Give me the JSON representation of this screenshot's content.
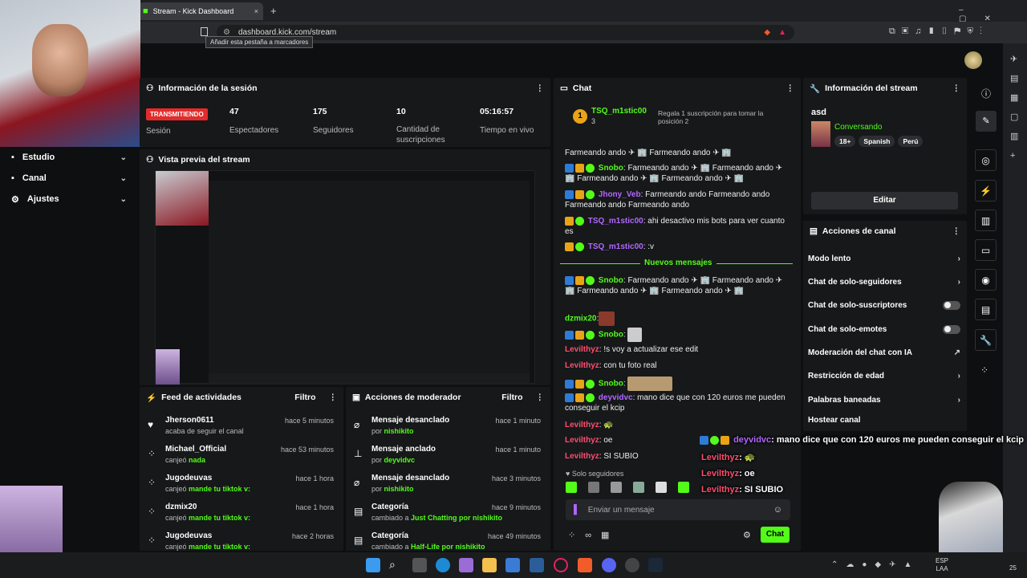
{
  "browser": {
    "tab_title": "Stream - Kick Dashboard",
    "url": "dashboard.kick.com/stream",
    "tooltip": "Añadir esta pestaña a marcadores",
    "new_tab": "+",
    "close_tab": "×"
  },
  "sidebar": {
    "items": [
      {
        "label": "Estudio",
        "icon": "studio-icon"
      },
      {
        "label": "Canal",
        "icon": "channel-icon"
      },
      {
        "label": "Ajustes",
        "icon": "gear-icon"
      }
    ]
  },
  "session": {
    "title": "Información de la sesión",
    "live_badge": "TRANSMITIENDO",
    "live_label": "Sesión",
    "stats": [
      {
        "value": "47",
        "label": "Espectadores"
      },
      {
        "value": "175",
        "label": "Seguidores"
      },
      {
        "value": "10",
        "label": "Cantidad de suscripciones"
      },
      {
        "value": "05:16:57",
        "label": "Tiempo en vivo"
      }
    ]
  },
  "preview": {
    "title": "Vista previa del stream"
  },
  "activity": {
    "title": "Feed de actividades",
    "filter": "Filtro",
    "rows": [
      {
        "icon": "heart-icon",
        "name": "Jherson0611",
        "sub": "acaba de seguir el canal",
        "bold": "",
        "time": "hace 5 minutos"
      },
      {
        "icon": "kicks-icon",
        "name": "Michael_Official",
        "sub": "canjeó ",
        "bold": "nada",
        "time": "hace 53 minutos"
      },
      {
        "icon": "kicks-icon",
        "name": "Jugodeuvas",
        "sub": "canjeó ",
        "bold": "mande tu tiktok v:",
        "time": "hace 1 hora"
      },
      {
        "icon": "kicks-icon",
        "name": "dzmix20",
        "sub": "canjeó ",
        "bold": "mande tu tiktok v:",
        "time": "hace 1 hora"
      },
      {
        "icon": "kicks-icon",
        "name": "Jugodeuvas",
        "sub": "canjeó ",
        "bold": "mande tu tiktok v:",
        "time": "hace 2 horas"
      }
    ]
  },
  "modactions": {
    "title": "Acciones de moderador",
    "filter": "Filtro",
    "rows": [
      {
        "icon": "unpin-icon",
        "name": "Mensaje desanclado",
        "sub": "por ",
        "bold": "nishikito",
        "time": "hace 1 minuto"
      },
      {
        "icon": "pin-icon",
        "name": "Mensaje anclado",
        "sub": "por ",
        "bold": "deyvidvc",
        "time": "hace 1 minuto"
      },
      {
        "icon": "unpin-icon",
        "name": "Mensaje desanclado",
        "sub": "por ",
        "bold": "nishikito",
        "time": "hace 3 minutos"
      },
      {
        "icon": "category-icon",
        "name": "Categoría",
        "sub": "cambiado a ",
        "bold": "Just Chatting por nishikito",
        "time": "hace 9 minutos"
      },
      {
        "icon": "category-icon",
        "name": "Categoría",
        "sub": "cambiado a ",
        "bold": "Half-Life por nishikito",
        "time": "hace 49 minutos"
      }
    ]
  },
  "chat": {
    "title": "Chat",
    "pinned_user": "TSQ_m1stic00",
    "pinned_count": "3",
    "gift_text": "Regala 1 suscripción para tomar la posición 2",
    "new_messages": "Nuevos mensajes",
    "messages": [
      {
        "user": "",
        "text": "Farmeando ando ✈ 🏢 Farmeando ando ✈ 🏢"
      },
      {
        "user": "Snobo",
        "text": ": Farmeando ando ✈ 🏢 Farmeando ando ✈ 🏢 Farmeando ando ✈ 🏢 Farmeando ando ✈ 🏢"
      },
      {
        "user": "Jhony_Veb",
        "text": ": Farmeando ando Farmeando ando Farmeando ando Farmeando ando"
      },
      {
        "user": "TSQ_m1stic00",
        "text": ": ahi desactivo mis bots para ver cuanto es"
      },
      {
        "user": "TSQ_m1stic00",
        "text": ": :v"
      },
      {
        "user": "Snobo",
        "text": ": Farmeando ando ✈ 🏢 Farmeando ando ✈ 🏢 Farmeando ando ✈ 🏢 Farmeando ando ✈ 🏢"
      },
      {
        "user": "dzmix20",
        "text": ":"
      },
      {
        "user": "Snobo",
        "text": ":"
      },
      {
        "user": "Levilthyz",
        "text": ": !s voy a actualizar ese edit"
      },
      {
        "user": "Levilthyz",
        "text": ": con tu foto real"
      },
      {
        "user": "Snobo",
        "text": ":"
      },
      {
        "user": "deyvidvc",
        "text": ": mano dice que con 120 euros me pueden conseguir el kcip"
      },
      {
        "user": "Levilthyz",
        "text": ": 🐢"
      },
      {
        "user": "Levilthyz",
        "text": ": oe"
      },
      {
        "user": "Levilthyz",
        "text": ": SI SUBIO"
      }
    ],
    "followers_only": "Solo seguidores",
    "input_placeholder": "Enviar un mensaje",
    "send": "Chat"
  },
  "streaminfo": {
    "title": "Información del stream",
    "stream_title": "asd",
    "category": "Conversando",
    "tags": [
      "18+",
      "Spanish",
      "Perú"
    ],
    "edit": "Editar"
  },
  "channelactions": {
    "title": "Acciones de canal",
    "items": [
      {
        "label": "Modo lento",
        "control": "chevron"
      },
      {
        "label": "Chat de solo-seguidores",
        "control": "chevron"
      },
      {
        "label": "Chat de solo-suscriptores",
        "control": "toggle"
      },
      {
        "label": "Chat de solo-emotes",
        "control": "toggle"
      },
      {
        "label": "Moderación del chat con IA",
        "control": "external"
      },
      {
        "label": "Restricción de edad",
        "control": "chevron"
      },
      {
        "label": "Palabras baneadas",
        "control": "chevron"
      },
      {
        "label": "Hostear canal",
        "control": "none"
      }
    ]
  },
  "overlay": {
    "line1_user": "deyvidvc",
    "line1_text": ": mano dice que con 120 euros me pueden conseguir el kcip",
    "line2_user": "Levilthyz",
    "line2_text": ": 🐢",
    "line3_user": "Levilthyz",
    "line3_text": ": oe",
    "line4_user": "Levilthyz",
    "line4_text": ": SI SUBIO"
  },
  "taskbar": {
    "lang": "ESP",
    "lang2": "LAA",
    "num": "25"
  },
  "colors": {
    "accent": "#53fc18",
    "live": "#e32b2b",
    "panel": "#16181a",
    "background": "#0d0f10"
  }
}
